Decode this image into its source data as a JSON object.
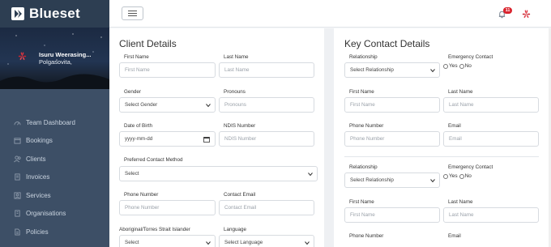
{
  "brand": {
    "name": "Blueset"
  },
  "user": {
    "name": "Isuru  Weerasing...",
    "location": "Polgasovita,"
  },
  "nav": [
    "Team Dashboard",
    "Bookings",
    "Clients",
    "Invoices",
    "Services",
    "Organisations",
    "Policies"
  ],
  "topbar": {
    "notification_count": "11"
  },
  "client": {
    "title": "Client Details",
    "first_name": {
      "label": "First Name",
      "placeholder": "First Name"
    },
    "last_name": {
      "label": "Last Name",
      "placeholder": "Last Name"
    },
    "gender": {
      "label": "Gender",
      "value": "Select Gender"
    },
    "pronouns": {
      "label": "Pronouns",
      "placeholder": "Pronouns"
    },
    "dob": {
      "label": "Date of Birth",
      "value": "yyyy-mm-dd"
    },
    "ndis": {
      "label": "NDIS Number",
      "placeholder": "NDIS Number"
    },
    "contact_method": {
      "label": "Preferred Contact Method",
      "value": "Select"
    },
    "phone": {
      "label": "Phone Number",
      "placeholder": "Phone Number"
    },
    "email": {
      "label": "Contact Email",
      "placeholder": "Contact Email"
    },
    "aboriginal": {
      "label": "Aboriginal/Torres Strait Islander",
      "value": "Select"
    },
    "language": {
      "label": "Language",
      "value": "Select Language"
    }
  },
  "contact": {
    "title": "Key Contact Details",
    "blocks": [
      {
        "relationship_label": "Relationship",
        "relationship_value": "Select Relationship",
        "emergency_label": "Emergency Contact",
        "yes": "Yes",
        "no": "No",
        "first_label": "First Name",
        "first_placeholder": "First Name",
        "last_label": "Last Name",
        "last_placeholder": "Last Name",
        "phone_label": "Phone Number",
        "phone_placeholder": "Phone Number",
        "email_label": "Email",
        "email_placeholder": "Email"
      },
      {
        "relationship_label": "Relationship",
        "relationship_value": "Select Relationship",
        "emergency_label": "Emergency Contact",
        "yes": "Yes",
        "no": "No",
        "first_label": "First Name",
        "first_placeholder": "First Name",
        "last_label": "Last Name",
        "last_placeholder": "Last Name",
        "phone_label": "Phone Number",
        "email_label": "Email"
      }
    ]
  },
  "colors": {
    "sidebar": "#3d4f66",
    "brand_bar": "#2d3e52",
    "badge": "#d9232d"
  }
}
